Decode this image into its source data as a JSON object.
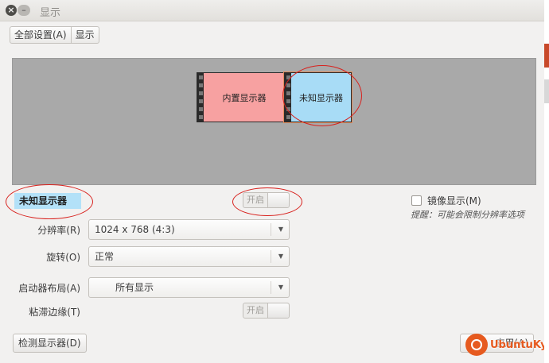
{
  "window": {
    "title": "显示",
    "close_glyph": "×",
    "minimize_glyph": "–"
  },
  "breadcrumb": {
    "all_settings": "全部设置(A)",
    "current": "显示"
  },
  "arrangement": {
    "monitors": [
      {
        "id": "builtin",
        "label": "内置显示器",
        "color": "#f7a1a1"
      },
      {
        "id": "unknown",
        "label": "未知显示器",
        "color": "#a8dcf6"
      }
    ]
  },
  "selected_monitor": {
    "name": "未知显示器",
    "power_label": "开启"
  },
  "mirror": {
    "label": "镜像显示(M)",
    "checked": false,
    "hint": "提醒：可能会限制分辨率选项"
  },
  "settings": {
    "resolution": {
      "label": "分辨率(R)",
      "value": "1024 x 768 (4:3)"
    },
    "rotation": {
      "label": "旋转(O)",
      "value": "正常"
    },
    "launcher": {
      "label": "启动器布局(A)",
      "value": "所有显示"
    },
    "sticky_edges": {
      "label": "粘滞边缘(T)",
      "toggle_label": "开启"
    }
  },
  "buttons": {
    "detect": "检测显示器(D)",
    "apply": "应用(A)"
  },
  "watermark": {
    "text": "UbuntuKylin",
    "color": "#e65a1f"
  },
  "colors": {
    "annotation": "#d8211d",
    "selection": "#b3e1f8"
  }
}
